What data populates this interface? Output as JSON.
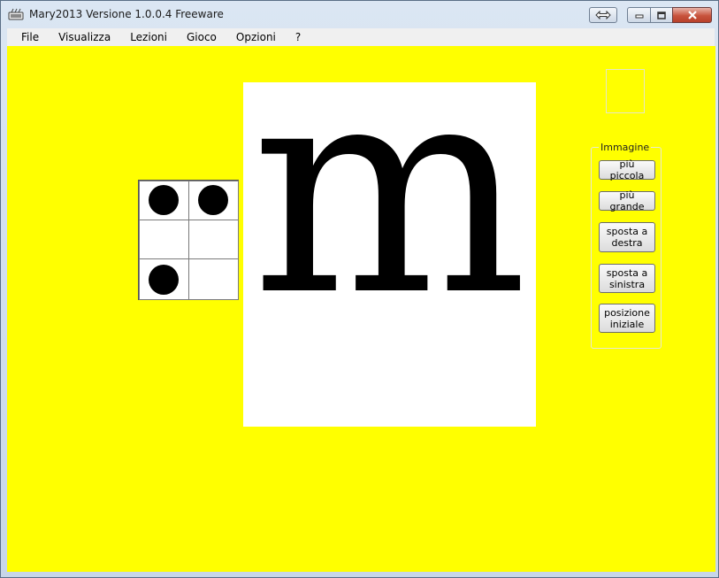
{
  "window": {
    "title": "Mary2013 Versione 1.0.0.4 Freeware"
  },
  "menu": {
    "items": [
      "File",
      "Visualizza",
      "Lezioni",
      "Gioco",
      "Opzioni",
      "?"
    ]
  },
  "main": {
    "letter": "m",
    "braille_cells": [
      [
        true,
        true
      ],
      [
        false,
        false
      ],
      [
        true,
        false
      ]
    ],
    "image_group": {
      "label": "Immagine",
      "buttons": [
        "più piccola",
        "più grande",
        "sposta a destra",
        "sposta a sinistra",
        "posizione iniziale"
      ]
    }
  },
  "colors": {
    "canvas": "#ffff00",
    "panel": "#ffffff",
    "dot": "#000000"
  }
}
